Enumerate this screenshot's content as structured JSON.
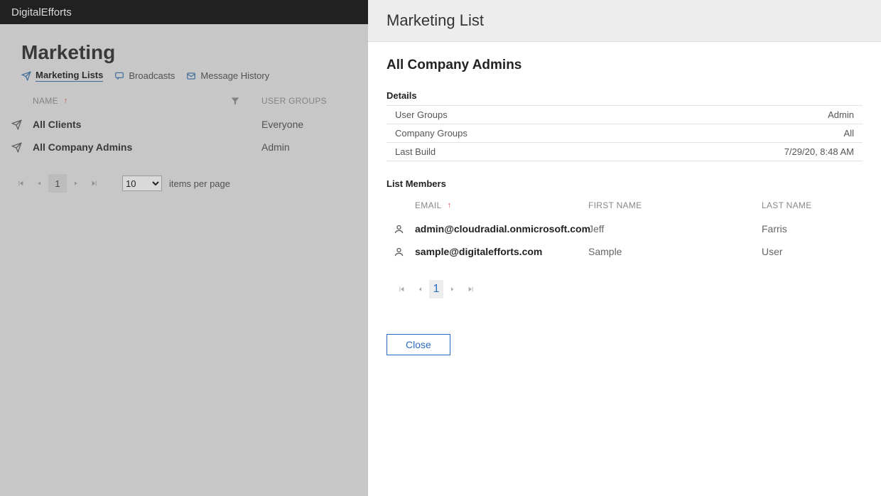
{
  "topbar": {
    "brand": "DigitalEfforts"
  },
  "page": {
    "title": "Marketing"
  },
  "tabs": [
    {
      "label": "Marketing Lists",
      "active": true
    },
    {
      "label": "Broadcasts",
      "active": false
    },
    {
      "label": "Message History",
      "active": false
    }
  ],
  "list": {
    "columns": {
      "name": "NAME",
      "user_groups": "USER GROUPS"
    },
    "rows": [
      {
        "name": "All Clients",
        "user_groups": "Everyone"
      },
      {
        "name": "All Company Admins",
        "user_groups": "Admin"
      }
    ]
  },
  "pager": {
    "current": "1",
    "page_size": "10",
    "items_per_page_label": "items per page"
  },
  "panel": {
    "header": "Marketing List",
    "title": "All Company Admins",
    "details_heading": "Details",
    "details": [
      {
        "k": "User Groups",
        "v": "Admin"
      },
      {
        "k": "Company Groups",
        "v": "All"
      },
      {
        "k": "Last Build",
        "v": "7/29/20, 8:48 AM"
      }
    ],
    "members_heading": "List Members",
    "member_columns": {
      "email": "EMAIL",
      "first": "FIRST NAME",
      "last": "LAST NAME"
    },
    "members": [
      {
        "email": "admin@cloudradial.onmicrosoft.com",
        "first": "Jeff",
        "last": "Farris"
      },
      {
        "email": "sample@digitalefforts.com",
        "first": "Sample",
        "last": "User"
      }
    ],
    "pager": {
      "current": "1"
    },
    "close_label": "Close"
  }
}
